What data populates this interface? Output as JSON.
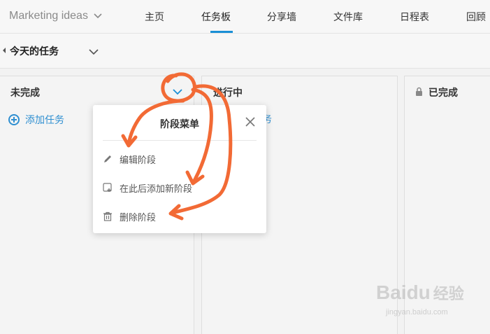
{
  "header": {
    "project_name": "Marketing ideas",
    "tabs": [
      {
        "label": "主页"
      },
      {
        "label": "任务板"
      },
      {
        "label": "分享墙"
      },
      {
        "label": "文件库"
      },
      {
        "label": "日程表"
      },
      {
        "label": "回顾"
      }
    ],
    "active_tab_index": 1
  },
  "subbar": {
    "title": "今天的任务"
  },
  "columns": [
    {
      "title": "未完成",
      "add_task": "添加任务"
    },
    {
      "title": "进行中",
      "add_task_partial": "务"
    },
    {
      "title": "已完成",
      "locked": true
    }
  ],
  "popup": {
    "title": "阶段菜单",
    "items": [
      {
        "label": "编辑阶段",
        "icon": "pencil-icon"
      },
      {
        "label": "在此后添加新阶段",
        "icon": "add-stage-icon"
      },
      {
        "label": "删除阶段",
        "icon": "trash-icon"
      }
    ]
  },
  "watermark": {
    "brand": "Baidu",
    "suffix": "经验",
    "url": "jingyan.baidu.com"
  },
  "colors": {
    "accent": "#1a8fd6",
    "link": "#2f8fd1",
    "annotation": "#f26a35"
  }
}
